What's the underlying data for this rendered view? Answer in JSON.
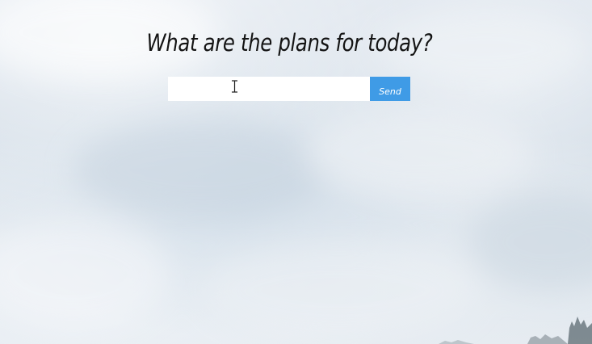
{
  "page": {
    "headline": "What are the plans for today?"
  },
  "form": {
    "input_value": "",
    "input_placeholder": "",
    "send_label": "Send"
  },
  "colors": {
    "send_button_bg": "#3f9be6",
    "headline_text": "#141414",
    "input_bg": "#ffffff"
  },
  "icons": {
    "cursor": "text-cursor-icon",
    "tree_silhouette": "treetops-icon"
  }
}
